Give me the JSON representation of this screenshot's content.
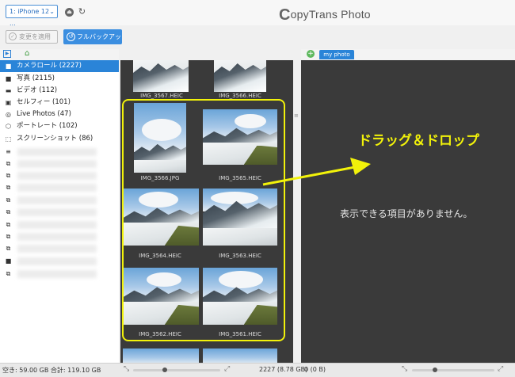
{
  "topbar": {
    "device_label": "1: iPhone 12 ...",
    "device_chevron": "⌄",
    "eject_icon": "⏏",
    "refresh_icon": "↻",
    "app_logo_c": "C",
    "app_logo_rest": "opyTrans Photo"
  },
  "toolbar": {
    "apply_label": "変更を適用",
    "apply_icon": "✓",
    "backup_label": "フルバックアップ",
    "backup_icon": "↺"
  },
  "left_tabs": {
    "ios_icon": "▶",
    "pc_icon": "⌂"
  },
  "albums": [
    {
      "label": "カメラロール (2227)",
      "icon": "camera-icon",
      "glyph": "■",
      "selected": true
    },
    {
      "label": "写真 (2115)",
      "icon": "camera-icon",
      "glyph": "■"
    },
    {
      "label": "ビデオ (112)",
      "icon": "video-icon",
      "glyph": "▬"
    },
    {
      "label": "セルフィー (101)",
      "icon": "selfie-icon",
      "glyph": "▣"
    },
    {
      "label": "Live Photos (47)",
      "icon": "live-photo-icon",
      "glyph": "◎"
    },
    {
      "label": "ポートレート (102)",
      "icon": "cube-icon",
      "glyph": "⬡"
    },
    {
      "label": "スクリーンショット (86)",
      "icon": "screenshot-icon",
      "glyph": "⬚"
    }
  ],
  "gallery": {
    "top_captions": [
      "IMG_3567.HEIC",
      "IMG_3566.HEIC"
    ],
    "items": [
      {
        "caption": "IMG_3566.JPG"
      },
      {
        "caption": "IMG_3565.HEIC"
      },
      {
        "caption": "IMG_3564.HEIC"
      },
      {
        "caption": "IMG_3563.HEIC"
      },
      {
        "caption": "IMG_3562.HEIC"
      },
      {
        "caption": "IMG_3561.HEIC"
      }
    ]
  },
  "right": {
    "tab_label": "my photo (0)",
    "add_icon": "+",
    "drag_drop_label": "ドラッグ＆ドロップ",
    "empty_message": "表示できる項目がありません。"
  },
  "status": {
    "storage": "空き: 59.00 GB 合計: 119.10 GB",
    "count": "2227 (8.78 GB)",
    "right_count": "0 (0 B)"
  },
  "colors": {
    "accent": "#2a84d8",
    "highlight": "#f2f20a",
    "panel_dark": "#3a3a3a"
  }
}
